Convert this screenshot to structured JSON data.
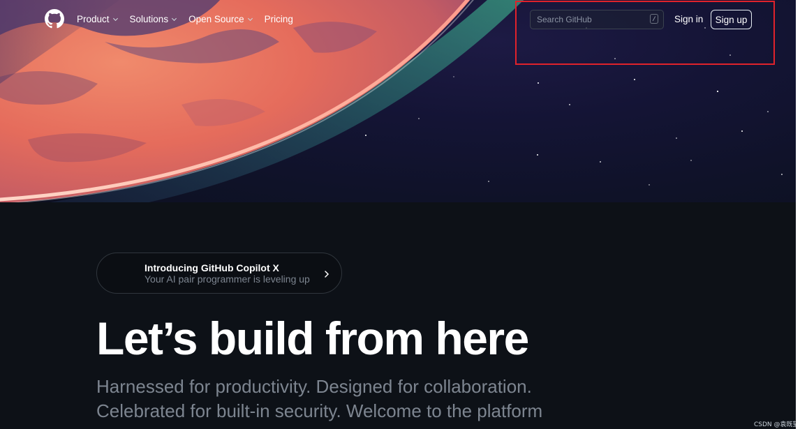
{
  "header": {
    "nav": [
      {
        "label": "Product",
        "has_dropdown": true
      },
      {
        "label": "Solutions",
        "has_dropdown": true
      },
      {
        "label": "Open Source",
        "has_dropdown": true
      },
      {
        "label": "Pricing",
        "has_dropdown": false
      }
    ],
    "search": {
      "placeholder": "Search GitHub",
      "shortcut": "/"
    },
    "sign_in": "Sign in",
    "sign_up": "Sign up"
  },
  "announcement": {
    "title": "Introducing GitHub Copilot X",
    "subtitle": "Your AI pair programmer is leveling up"
  },
  "hero": {
    "headline": "Let’s build from here",
    "subhead_line1": "Harnessed for productivity. Designed for collaboration.",
    "subhead_line2": "Celebrated for built-in security. Welcome to the platform"
  },
  "watermark": "CSDN @袁既望",
  "colors": {
    "background": "#0d1117",
    "muted_text": "#7d8590",
    "highlight_border": "#e0222b",
    "planet": "#e9705f"
  },
  "icons": {
    "logo": "github-logo-icon",
    "dropdown": "chevron-down-icon",
    "pill_arrow": "chevron-right-icon"
  }
}
